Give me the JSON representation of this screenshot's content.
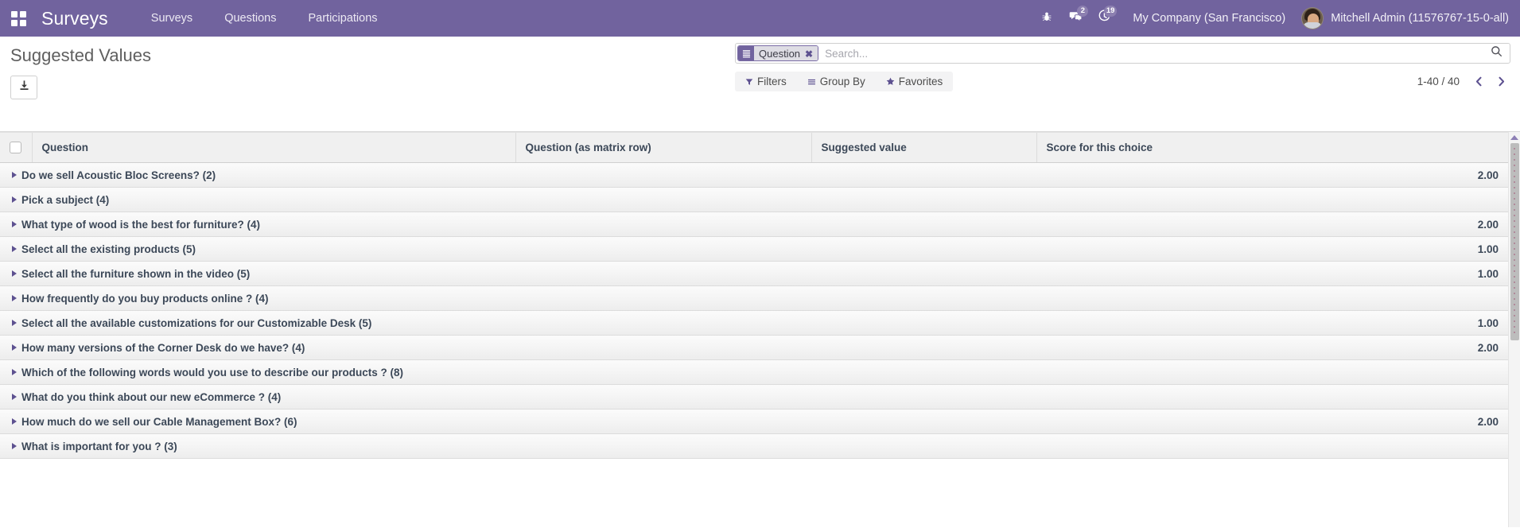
{
  "navbar": {
    "apps_icon": "apps-grid-icon",
    "brand": "Surveys",
    "menu_items": [
      {
        "label": "Surveys"
      },
      {
        "label": "Questions"
      },
      {
        "label": "Participations"
      }
    ],
    "icons": {
      "debug": "bug-icon",
      "messaging": "messages-icon",
      "activities": "clock-icon"
    },
    "messaging_count": "2",
    "activities_count": "19",
    "company": "My Company (San Francisco)",
    "user": "Mitchell Admin (11576767-15-0-all)",
    "accent_color": "#71639e"
  },
  "control_panel": {
    "title": "Suggested Values",
    "download_icon": "download-icon",
    "search": {
      "facet": {
        "icon": "group-by-icon",
        "label": "Question",
        "close_icon": "close-icon"
      },
      "placeholder": "Search...",
      "value": "",
      "search_icon": "search-icon"
    },
    "buttons": [
      {
        "label": "Filters",
        "icon": "filter-funnel-icon"
      },
      {
        "label": "Group By",
        "icon": "group-by-lines-icon"
      },
      {
        "label": "Favorites",
        "icon": "star-icon"
      }
    ],
    "pager": {
      "value": "1-40 / 40",
      "prev_icon": "chevron-left-icon",
      "next_icon": "chevron-right-icon"
    }
  },
  "list": {
    "select_all_checkbox": "unchecked",
    "columns": [
      {
        "label": "Question"
      },
      {
        "label": "Question (as matrix row)"
      },
      {
        "label": "Suggested value"
      },
      {
        "label": "Score for this choice"
      }
    ],
    "groups": [
      {
        "label": "Do we sell Acoustic Bloc Screens? (2)",
        "score": "2.00"
      },
      {
        "label": "Pick a subject (4)",
        "score": ""
      },
      {
        "label": "What type of wood is the best for furniture? (4)",
        "score": "2.00"
      },
      {
        "label": "Select all the existing products (5)",
        "score": "1.00"
      },
      {
        "label": "Select all the furniture shown in the video (5)",
        "score": "1.00"
      },
      {
        "label": "How frequently do you buy products online ? (4)",
        "score": ""
      },
      {
        "label": "Select all the available customizations for our Customizable Desk (5)",
        "score": "1.00"
      },
      {
        "label": "How many versions of the Corner Desk do we have? (4)",
        "score": "2.00"
      },
      {
        "label": "Which of the following words would you use to describe our products ? (8)",
        "score": ""
      },
      {
        "label": "What do you think about our new eCommerce ? (4)",
        "score": ""
      },
      {
        "label": "How much do we sell our Cable Management Box? (6)",
        "score": "2.00"
      },
      {
        "label": "What is important for you ? (3)",
        "score": ""
      }
    ]
  }
}
